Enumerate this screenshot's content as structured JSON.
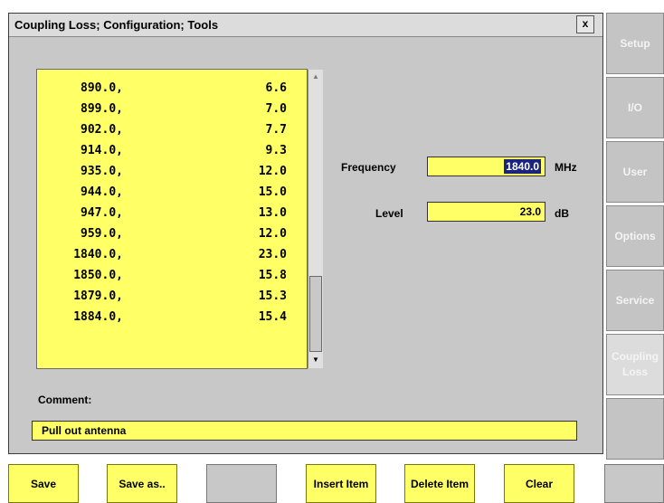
{
  "dialog": {
    "title": "Coupling Loss; Configuration; Tools",
    "close_label": "x"
  },
  "table": {
    "rows": [
      {
        "freq": "890.0,",
        "level": "6.6"
      },
      {
        "freq": "899.0,",
        "level": "7.0"
      },
      {
        "freq": "902.0,",
        "level": "7.7"
      },
      {
        "freq": "914.0,",
        "level": "9.3"
      },
      {
        "freq": "935.0,",
        "level": "12.0"
      },
      {
        "freq": "944.0,",
        "level": "15.0"
      },
      {
        "freq": "947.0,",
        "level": "13.0"
      },
      {
        "freq": "959.0,",
        "level": "12.0"
      },
      {
        "freq": "1840.0,",
        "level": "23.0"
      },
      {
        "freq": "1850.0,",
        "level": "15.8"
      },
      {
        "freq": "1879.0,",
        "level": "15.3"
      },
      {
        "freq": "1884.0,",
        "level": "15.4"
      }
    ]
  },
  "frequency": {
    "label": "Frequency",
    "value": "1840.0",
    "unit": "MHz"
  },
  "level": {
    "label": "Level",
    "value": "23.0",
    "unit": "dB"
  },
  "comment": {
    "label": "Comment:",
    "value": "Pull out antenna"
  },
  "side_buttons": [
    "Setup",
    "I/O",
    "User",
    "Options",
    "Service",
    "Coupling Loss",
    ""
  ],
  "bottom_buttons": [
    "Save",
    "Save as..",
    "",
    "Insert Item",
    "Delete Item",
    "Clear",
    ""
  ]
}
